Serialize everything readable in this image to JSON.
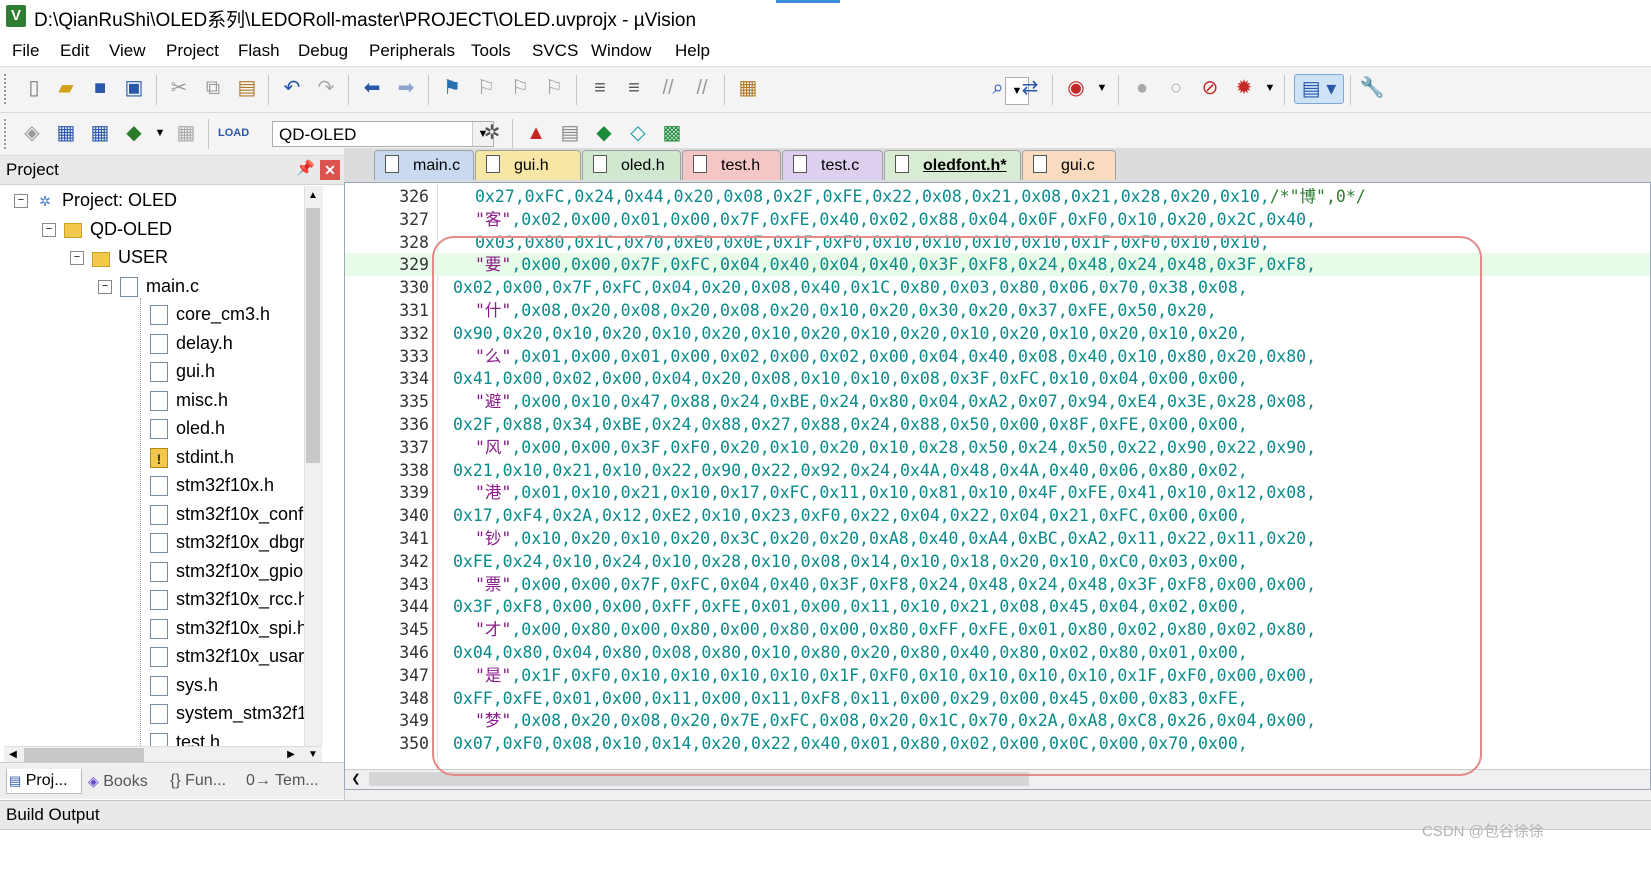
{
  "window": {
    "title": "D:\\QianRuShi\\OLED系列\\LEDORoll-master\\PROJECT\\OLED.uvprojx - µVision",
    "app_icon_letter": "V"
  },
  "menu": [
    "File",
    "Edit",
    "View",
    "Project",
    "Flash",
    "Debug",
    "Peripherals",
    "Tools",
    "SVCS",
    "Window",
    "Help"
  ],
  "toolbar2": {
    "target": "QD-OLED"
  },
  "project_panel": {
    "title": "Project",
    "tree": [
      {
        "label": "Project: OLED",
        "level": 0,
        "type": "project",
        "expander": "−"
      },
      {
        "label": "QD-OLED",
        "level": 1,
        "type": "target",
        "expander": "−"
      },
      {
        "label": "USER",
        "level": 2,
        "type": "folder",
        "expander": "−"
      },
      {
        "label": "main.c",
        "level": 3,
        "type": "file",
        "expander": "−"
      },
      {
        "label": "core_cm3.h",
        "level": 4,
        "type": "file"
      },
      {
        "label": "delay.h",
        "level": 4,
        "type": "file"
      },
      {
        "label": "gui.h",
        "level": 4,
        "type": "file"
      },
      {
        "label": "misc.h",
        "level": 4,
        "type": "file"
      },
      {
        "label": "oled.h",
        "level": 4,
        "type": "file"
      },
      {
        "label": "stdint.h",
        "level": 4,
        "type": "warn"
      },
      {
        "label": "stm32f10x.h",
        "level": 4,
        "type": "file"
      },
      {
        "label": "stm32f10x_conf.",
        "level": 4,
        "type": "file"
      },
      {
        "label": "stm32f10x_dbgr",
        "level": 4,
        "type": "file"
      },
      {
        "label": "stm32f10x_gpio.",
        "level": 4,
        "type": "file"
      },
      {
        "label": "stm32f10x_rcc.h",
        "level": 4,
        "type": "file"
      },
      {
        "label": "stm32f10x_spi.h",
        "level": 4,
        "type": "file"
      },
      {
        "label": "stm32f10x_usart",
        "level": 4,
        "type": "file"
      },
      {
        "label": "sys.h",
        "level": 4,
        "type": "file"
      },
      {
        "label": "system_stm32f1",
        "level": 4,
        "type": "file"
      },
      {
        "label": "test.h",
        "level": 4,
        "type": "file"
      }
    ],
    "tabs": [
      "Proj...",
      "Books",
      "{} Fun...",
      "0→ Tem..."
    ]
  },
  "editor": {
    "tabs": [
      {
        "label": "main.c",
        "color": "#c9daf0",
        "active": false
      },
      {
        "label": "gui.h",
        "color": "#f7e7a6",
        "active": false
      },
      {
        "label": "oled.h",
        "color": "#cfe8cf",
        "active": false
      },
      {
        "label": "test.h",
        "color": "#f5c6c6",
        "active": false
      },
      {
        "label": "test.c",
        "color": "#ddd0ee",
        "active": false
      },
      {
        "label": "oledfont.h*",
        "color": "#d7ecd2",
        "active": true
      },
      {
        "label": "gui.c",
        "color": "#f9dcc0",
        "active": false
      }
    ],
    "lines": [
      {
        "n": "326",
        "indent": 1,
        "text": "0x27,0xFC,0x24,0x44,0x20,0x08,0x2F,0xFE,0x22,0x08,0x21,0x08,0x21,0x28,0x20,0x10,/*\"博\",0*/"
      },
      {
        "n": "327",
        "indent": 1,
        "text": "\"客\",0x02,0x00,0x01,0x00,0x7F,0xFE,0x40,0x02,0x88,0x04,0x0F,0xF0,0x10,0x20,0x2C,0x40,"
      },
      {
        "n": "328",
        "indent": 1,
        "text": "0x03,0x80,0x1C,0x70,0xE0,0x0E,0x1F,0xF0,0x10,0x10,0x10,0x10,0x1F,0xF0,0x10,0x10,"
      },
      {
        "n": "329",
        "indent": 1,
        "text": "\"要\",0x00,0x00,0x7F,0xFC,0x04,0x40,0x04,0x40,0x3F,0xF8,0x24,0x48,0x24,0x48,0x3F,0xF8,",
        "hl": true
      },
      {
        "n": "330",
        "indent": 0,
        "text": "0x02,0x00,0x7F,0xFC,0x04,0x20,0x08,0x40,0x1C,0x80,0x03,0x80,0x06,0x70,0x38,0x08,"
      },
      {
        "n": "331",
        "indent": 1,
        "text": "\"什\",0x08,0x20,0x08,0x20,0x08,0x20,0x10,0x20,0x30,0x20,0x37,0xFE,0x50,0x20,"
      },
      {
        "n": "332",
        "indent": 0,
        "text": "0x90,0x20,0x10,0x20,0x10,0x20,0x10,0x20,0x10,0x20,0x10,0x20,0x10,0x20,0x10,0x20,"
      },
      {
        "n": "333",
        "indent": 1,
        "text": "\"么\",0x01,0x00,0x01,0x00,0x02,0x00,0x02,0x00,0x04,0x40,0x08,0x40,0x10,0x80,0x20,0x80,"
      },
      {
        "n": "334",
        "indent": 0,
        "text": "0x41,0x00,0x02,0x00,0x04,0x20,0x08,0x10,0x10,0x08,0x3F,0xFC,0x10,0x04,0x00,0x00,"
      },
      {
        "n": "335",
        "indent": 1,
        "text": "\"避\",0x00,0x10,0x47,0x88,0x24,0xBE,0x24,0x80,0x04,0xA2,0x07,0x94,0xE4,0x3E,0x28,0x08,"
      },
      {
        "n": "336",
        "indent": 0,
        "text": "0x2F,0x88,0x34,0xBE,0x24,0x88,0x27,0x88,0x24,0x88,0x50,0x00,0x8F,0xFE,0x00,0x00,"
      },
      {
        "n": "337",
        "indent": 1,
        "text": "\"风\",0x00,0x00,0x3F,0xF0,0x20,0x10,0x20,0x10,0x28,0x50,0x24,0x50,0x22,0x90,0x22,0x90,"
      },
      {
        "n": "338",
        "indent": 0,
        "text": "0x21,0x10,0x21,0x10,0x22,0x90,0x22,0x92,0x24,0x4A,0x48,0x4A,0x40,0x06,0x80,0x02,"
      },
      {
        "n": "339",
        "indent": 1,
        "text": "\"港\",0x01,0x10,0x21,0x10,0x17,0xFC,0x11,0x10,0x81,0x10,0x4F,0xFE,0x41,0x10,0x12,0x08,"
      },
      {
        "n": "340",
        "indent": 0,
        "text": "0x17,0xF4,0x2A,0x12,0xE2,0x10,0x23,0xF0,0x22,0x04,0x22,0x04,0x21,0xFC,0x00,0x00,"
      },
      {
        "n": "341",
        "indent": 1,
        "text": "\"钞\",0x10,0x20,0x10,0x20,0x3C,0x20,0x20,0xA8,0x40,0xA4,0xBC,0xA2,0x11,0x22,0x11,0x20,"
      },
      {
        "n": "342",
        "indent": 0,
        "text": "0xFE,0x24,0x10,0x24,0x10,0x28,0x10,0x08,0x14,0x10,0x18,0x20,0x10,0xC0,0x03,0x00,"
      },
      {
        "n": "343",
        "indent": 1,
        "text": "\"票\",0x00,0x00,0x7F,0xFC,0x04,0x40,0x3F,0xF8,0x24,0x48,0x24,0x48,0x3F,0xF8,0x00,0x00,"
      },
      {
        "n": "344",
        "indent": 0,
        "text": "0x3F,0xF8,0x00,0x00,0xFF,0xFE,0x01,0x00,0x11,0x10,0x21,0x08,0x45,0x04,0x02,0x00,"
      },
      {
        "n": "345",
        "indent": 1,
        "text": "\"才\",0x00,0x80,0x00,0x80,0x00,0x80,0x00,0x80,0xFF,0xFE,0x01,0x80,0x02,0x80,0x02,0x80,"
      },
      {
        "n": "346",
        "indent": 0,
        "text": "0x04,0x80,0x04,0x80,0x08,0x80,0x10,0x80,0x20,0x80,0x40,0x80,0x02,0x80,0x01,0x00,"
      },
      {
        "n": "347",
        "indent": 1,
        "text": "\"是\",0x1F,0xF0,0x10,0x10,0x10,0x10,0x1F,0xF0,0x10,0x10,0x10,0x10,0x1F,0xF0,0x00,0x00,"
      },
      {
        "n": "348",
        "indent": 0,
        "text": "0xFF,0xFE,0x01,0x00,0x11,0x00,0x11,0xF8,0x11,0x00,0x29,0x00,0x45,0x00,0x83,0xFE,"
      },
      {
        "n": "349",
        "indent": 1,
        "text": "\"梦\",0x08,0x20,0x08,0x20,0x7E,0xFC,0x08,0x20,0x1C,0x70,0x2A,0xA8,0xC8,0x26,0x04,0x00,"
      },
      {
        "n": "350",
        "indent": 0,
        "text": "0x07,0xF0,0x08,0x10,0x14,0x20,0x22,0x40,0x01,0x80,0x02,0x00,0x0C,0x00,0x70,0x00,"
      }
    ]
  },
  "build_output": {
    "title": "Build Output"
  },
  "watermark": "CSDN @包谷徐徐",
  "colors": {
    "hex_text": "#0a8a8a",
    "comment": "#2e7d32",
    "string": "#8b1c8b",
    "annotation_box": "#e48a8a"
  }
}
